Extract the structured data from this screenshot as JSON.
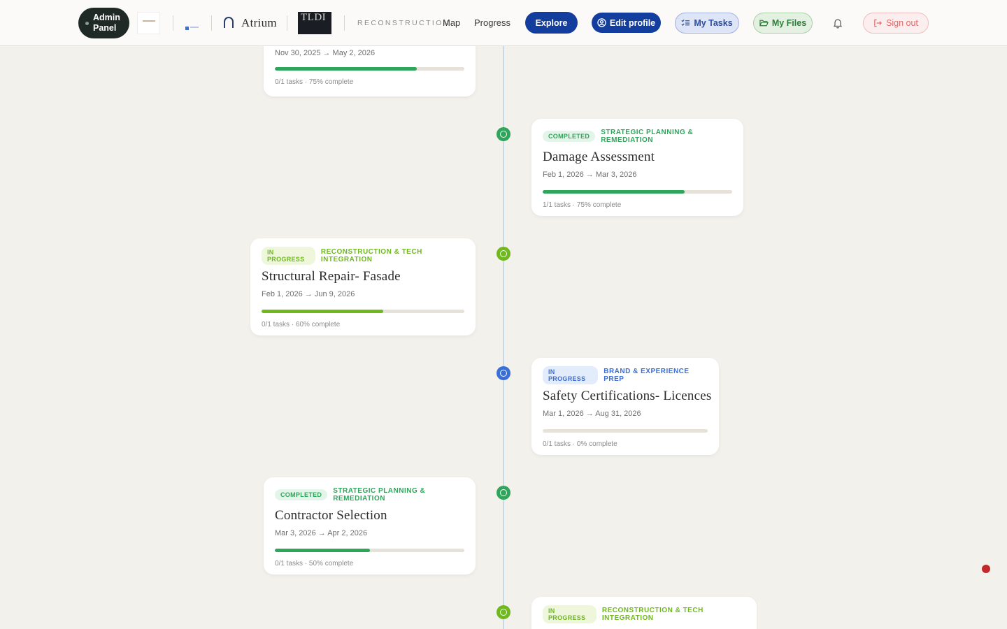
{
  "header": {
    "admin_label": "Admin Panel",
    "atrium_label": "Atrium",
    "tldi_label": "TLDI",
    "section_label": "RECONSTRUCTION",
    "nav": {
      "map": "Map",
      "progress": "Progress"
    },
    "buttons": {
      "explore": "Explore",
      "edit_profile": "Edit profile",
      "my_tasks": "My Tasks",
      "my_files": "My Files",
      "sign_out": "Sign out"
    }
  },
  "colors": {
    "completed": "#2ea55a",
    "reconstruction": "#6fb81e",
    "brand": "#3a6fd8",
    "primary": "#143e9e"
  },
  "timeline": [
    {
      "status": "",
      "category": "",
      "title": "",
      "dates": "Nov 30, 2025 → May 2, 2026",
      "meta": "0/1 tasks · 75% complete",
      "progress": 75
    },
    {
      "status": "COMPLETED",
      "category": "STRATEGIC PLANNING & REMEDIATION",
      "title": "Damage Assessment",
      "dates": "Feb 1, 2026 → Mar 3, 2026",
      "meta": "1/1 tasks · 75% complete",
      "progress": 75
    },
    {
      "status": "IN PROGRESS",
      "category": "RECONSTRUCTION & TECH INTEGRATION",
      "title": "Structural Repair- Fasade",
      "dates": "Feb 1, 2026 → Jun 9, 2026",
      "meta": "0/1 tasks · 60% complete",
      "progress": 60
    },
    {
      "status": "IN PROGRESS",
      "category": "BRAND & EXPERIENCE PREP",
      "title": "Safety Certifications- Licences",
      "dates": "Mar 1, 2026 → Aug 31, 2026",
      "meta": "0/1 tasks · 0% complete",
      "progress": 0
    },
    {
      "status": "COMPLETED",
      "category": "STRATEGIC PLANNING & REMEDIATION",
      "title": "Contractor Selection",
      "dates": "Mar 3, 2026 → Apr 2, 2026",
      "meta": "0/1 tasks · 50% complete",
      "progress": 50
    },
    {
      "status": "IN PROGRESS",
      "category": "RECONSTRUCTION & TECH INTEGRATION",
      "title": "",
      "dates": "",
      "meta": "",
      "progress": 0
    }
  ]
}
